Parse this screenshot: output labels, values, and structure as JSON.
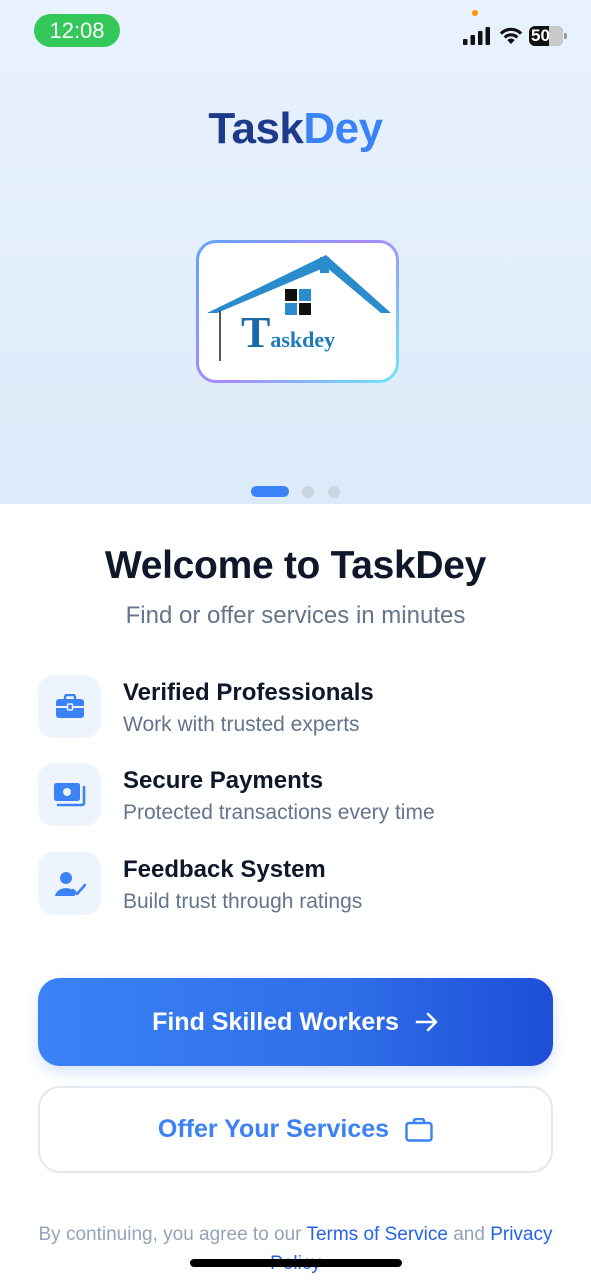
{
  "status_bar": {
    "time": "12:08",
    "battery": "50",
    "icons": [
      "signal-icon",
      "wifi-icon",
      "battery-icon"
    ]
  },
  "brand": {
    "part1": "Task",
    "part2": "Dey"
  },
  "logo": {
    "letter": "T",
    "rest": "askdey"
  },
  "carousel": {
    "pages": 3,
    "active": 0
  },
  "welcome": {
    "title": "Welcome to TaskDey",
    "subtitle": "Find or offer services in minutes"
  },
  "features": [
    {
      "icon": "briefcase-icon",
      "title": "Verified Professionals",
      "desc": "Work with trusted experts"
    },
    {
      "icon": "payment-icon",
      "title": "Secure Payments",
      "desc": "Protected transactions every time"
    },
    {
      "icon": "user-check-icon",
      "title": "Feedback System",
      "desc": "Build trust through ratings"
    }
  ],
  "buttons": {
    "primary": {
      "label": "Find Skilled Workers",
      "icon": "arrow-right-icon"
    },
    "secondary": {
      "label": "Offer Your Services",
      "icon": "briefcase-outline-icon"
    }
  },
  "terms": {
    "prefix": "By continuing, you agree to our ",
    "tos": "Terms of Service",
    "and": " and ",
    "privacy": "Privacy Policy"
  },
  "colors": {
    "primary": "#3b82f6",
    "primary_dark": "#1d4ed8",
    "brand_dark": "#1e3a8a",
    "status_green": "#34c759",
    "text_dark": "#0f172a",
    "text_muted": "#64748b"
  }
}
